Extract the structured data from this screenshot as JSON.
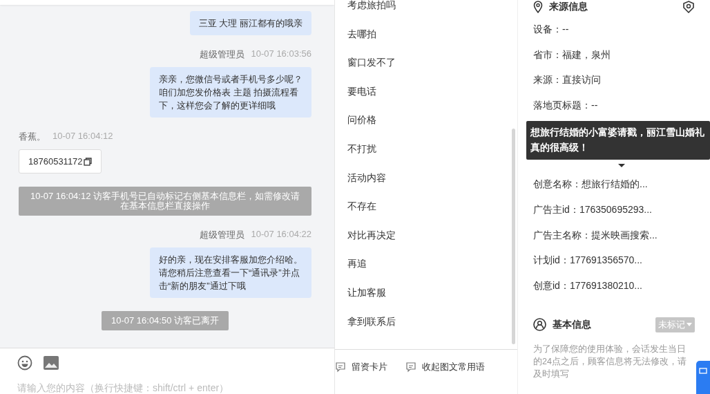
{
  "chat": {
    "messages": [
      {
        "kind": "agent",
        "text": "三亚 大理 丽江都有的哦亲"
      },
      {
        "kind": "agent",
        "sender": "超级管理员",
        "time": "10-07 16:03:56",
        "text": "亲亲，您微信号或者手机号多少呢？咱们加您发价格表 主题 拍摄流程看下，这样您会了解的更详细哦"
      },
      {
        "kind": "visitor",
        "sender": "香蕉。",
        "time": "10-07 16:04:12",
        "text": "18760531172"
      },
      {
        "kind": "system",
        "text": "10-07 16:04:12 访客手机号已自动标记右侧基本信息栏，如需修改请在基本信息栏直接操作"
      },
      {
        "kind": "agent",
        "sender": "超级管理员",
        "time": "10-07 16:04:22",
        "text": "好的亲，现在安排客服加您介绍哈。请您稍后注意查看一下“通讯录”并点击“新的朋友”通过下哦"
      },
      {
        "kind": "system",
        "text": "10-07 16:04:50 访客已离开"
      }
    ],
    "input": {
      "placeholder": "请输入您的内容（换行快捷键：shift/ctrl + enter）"
    }
  },
  "quick_replies": {
    "items": [
      "考虑旅拍吗",
      "去哪拍",
      "窗口发不了",
      "要电话",
      "问价格",
      "不打扰",
      "活动内容",
      "不存在",
      "对比再决定",
      "再追",
      "让加客服",
      "拿到联系后"
    ],
    "actions": [
      "留资卡片",
      "收起图文常用语"
    ]
  },
  "source_info": {
    "title": "来源信息",
    "rows_above": [
      "设备：--",
      "省市：福建，泉州",
      "来源：直接访问",
      "落地页标题：--"
    ],
    "rows_below": [
      "创意名称：想旅行结婚的...",
      "广告主id：176350695293...",
      "广告主名称：提米映画搜索...",
      "计划id：177691356570...",
      "创意id：177691380210..."
    ],
    "tooltip": "想旅行结婚的小富婆请戳，丽江雪山婚礼真的很高级！"
  },
  "basic_info": {
    "title": "基本信息",
    "tag": "未标记",
    "note": "为了保障您的使用体验，会话发生当日的24点之后，顾客信息将无法修改，请及时填写"
  }
}
